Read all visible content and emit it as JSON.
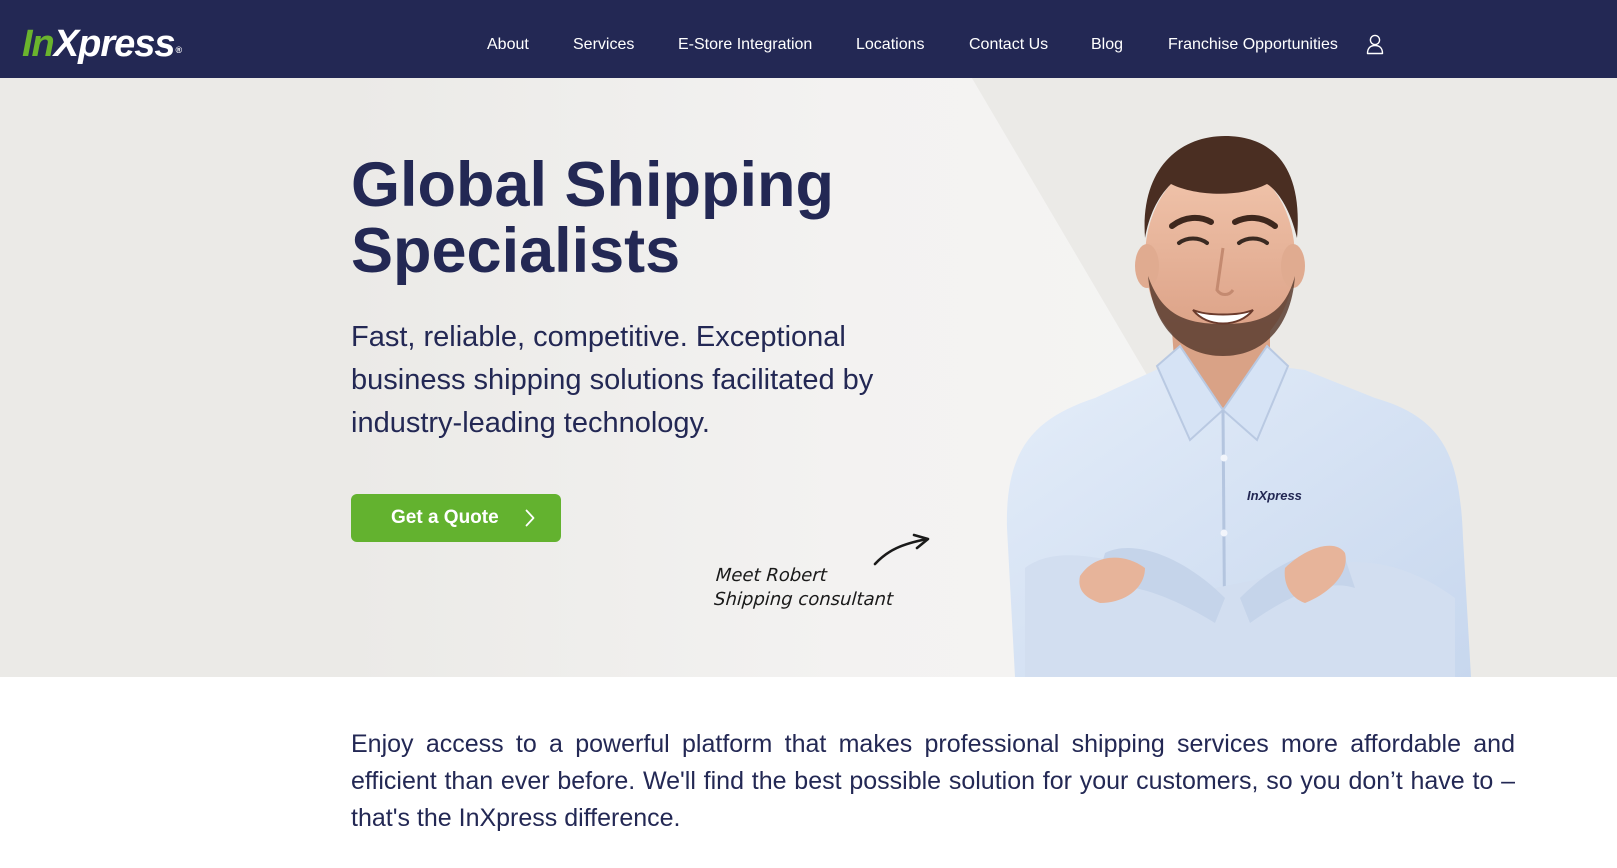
{
  "brand": {
    "logo_prefix": "In",
    "logo_suffix": "Xpress",
    "logo_mark": "®",
    "colors": {
      "navy": "#232854",
      "green": "#63b22f",
      "hero_bg": "#ebeae7"
    }
  },
  "nav": {
    "items": [
      {
        "label": "About"
      },
      {
        "label": "Services"
      },
      {
        "label": "E-Store Integration"
      },
      {
        "label": "Locations"
      },
      {
        "label": "Contact Us"
      },
      {
        "label": "Blog"
      },
      {
        "label": "Franchise Opportunities"
      }
    ],
    "account_icon": "user-icon"
  },
  "hero": {
    "title": "Global Shipping Specialists",
    "subtitle": "Fast, reliable, competitive. Exceptional business shipping solutions facilitated by industry-leading technology.",
    "cta_label": "Get a Quote",
    "cta_icon": "chevron-right-icon",
    "caption_line1": "Meet Robert",
    "caption_line2": "Shipping consultant",
    "shirt_logo": "InXpress"
  },
  "intro": {
    "text": "Enjoy access to a powerful platform that makes professional shipping services more affordable and efficient than ever before. We'll find the best possible solution for your customers, so you don’t have to – that's the InXpress difference."
  }
}
